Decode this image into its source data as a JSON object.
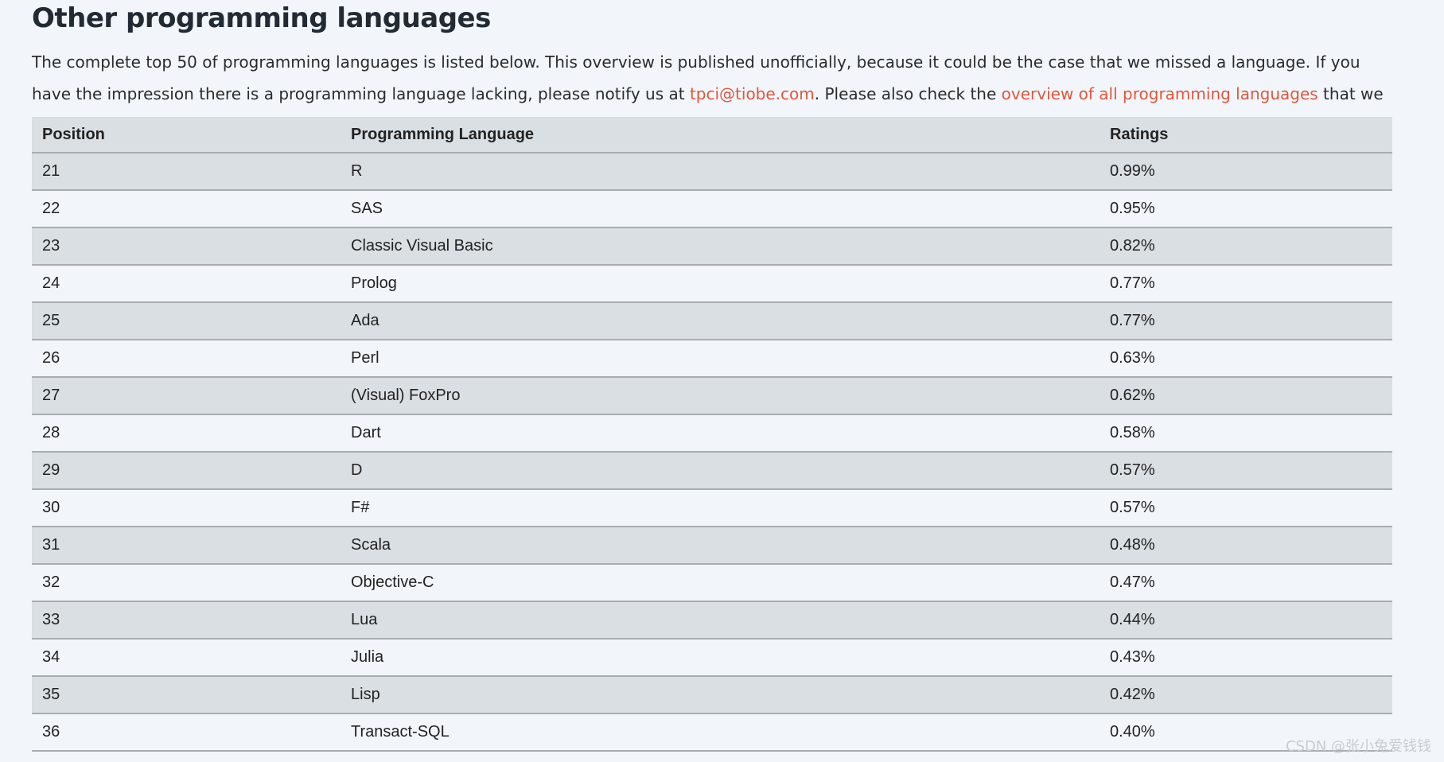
{
  "page": {
    "title": "Other programming languages",
    "intro": {
      "part1": "The complete top 50 of programming languages is listed below. This overview is published unofficially, because it could be the case that we missed a language. If you have the impression there is a programming language lacking, please notify us at ",
      "email_link": "tpci@tiobe.com",
      "part2": ". Please also check the ",
      "overview_link": "overview of all programming languages",
      "part3": " that we monitor."
    }
  },
  "table": {
    "headers": {
      "position": "Position",
      "language": "Programming Language",
      "ratings": "Ratings"
    },
    "rows": [
      {
        "position": "21",
        "language": "R",
        "rating": "0.99%"
      },
      {
        "position": "22",
        "language": "SAS",
        "rating": "0.95%"
      },
      {
        "position": "23",
        "language": "Classic Visual Basic",
        "rating": "0.82%"
      },
      {
        "position": "24",
        "language": "Prolog",
        "rating": "0.77%"
      },
      {
        "position": "25",
        "language": "Ada",
        "rating": "0.77%"
      },
      {
        "position": "26",
        "language": "Perl",
        "rating": "0.63%"
      },
      {
        "position": "27",
        "language": "(Visual) FoxPro",
        "rating": "0.62%"
      },
      {
        "position": "28",
        "language": "Dart",
        "rating": "0.58%"
      },
      {
        "position": "29",
        "language": "D",
        "rating": "0.57%"
      },
      {
        "position": "30",
        "language": "F#",
        "rating": "0.57%"
      },
      {
        "position": "31",
        "language": "Scala",
        "rating": "0.48%"
      },
      {
        "position": "32",
        "language": "Objective-C",
        "rating": "0.47%"
      },
      {
        "position": "33",
        "language": "Lua",
        "rating": "0.44%"
      },
      {
        "position": "34",
        "language": "Julia",
        "rating": "0.43%"
      },
      {
        "position": "35",
        "language": "Lisp",
        "rating": "0.42%"
      },
      {
        "position": "36",
        "language": "Transact-SQL",
        "rating": "0.40%"
      }
    ]
  },
  "watermark": "CSDN @张小兔爱钱钱",
  "colors": {
    "background": "#f2f6fa",
    "stripe": "#dadfe3",
    "link": "#e0573d",
    "row_border": "#a9adb2"
  }
}
